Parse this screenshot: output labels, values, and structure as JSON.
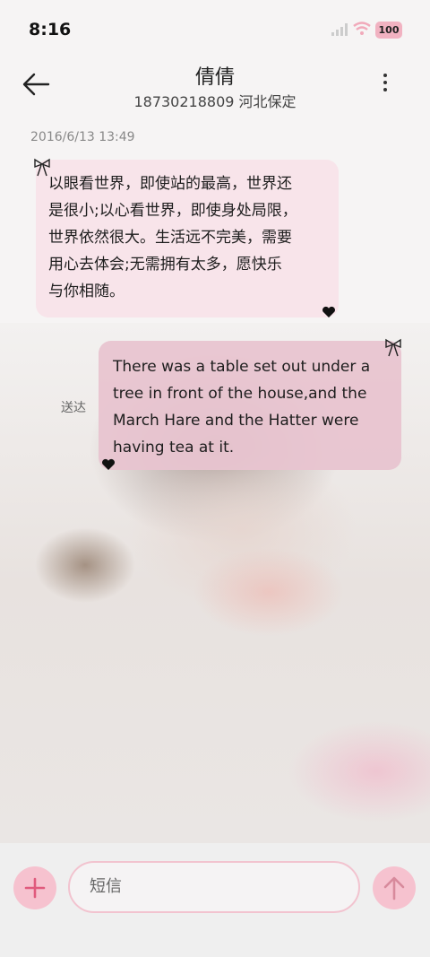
{
  "status_bar": {
    "time": "8:16",
    "battery": "100"
  },
  "header": {
    "name": "倩倩",
    "subtitle": "18730218809 河北保定"
  },
  "conversation": {
    "timestamp": "2016/6/13 13:49",
    "incoming_lines": [
      "以眼看世界，即使站的最高，世界还",
      "是很小;以心看世界，即使身处局限，",
      "世界依然很大。生活远不完美，需要",
      "用心去体会;无需拥有太多，愿快乐",
      "与你相随。"
    ],
    "outgoing_lines": [
      "There was a table set out under a",
      "tree in front of the house,and the",
      "March Hare and the Hatter were",
      "having tea at it."
    ],
    "outgoing_status": "送达"
  },
  "composer": {
    "placeholder": "短信"
  },
  "icons": {
    "back": "arrow-left-icon",
    "more": "more-vertical-icon",
    "signal": "signal-icon",
    "wifi": "wifi-icon",
    "bow": "bow-icon",
    "heart": "heart-icon",
    "add": "plus-icon",
    "send": "arrow-up-icon"
  },
  "colors": {
    "accent": "#f6c2cf",
    "incoming_bubble": "#f8e4ea",
    "outgoing_bubble": "#e8c4d0"
  }
}
